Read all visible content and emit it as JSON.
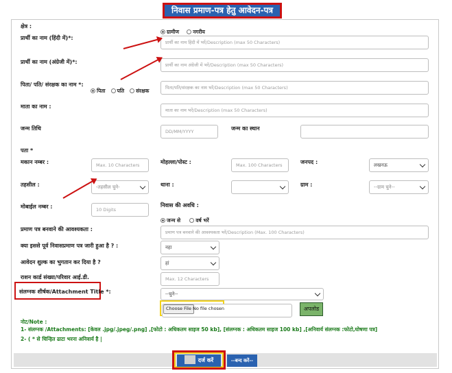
{
  "title": "निवास प्रमाण-पत्र हेतु आवेदन-पत्र",
  "area": {
    "label": "क्षेत्र :",
    "options": [
      "ग्रामीण",
      "नगरीय"
    ],
    "selected": "ग्रामीण"
  },
  "name_hindi": {
    "label": "प्रार्थी का नाम (हिंदी में)*:",
    "placeholder": "प्रार्थी का नाम हिंदी में भरें/Description (max 50 Characters)"
  },
  "name_english": {
    "label": "प्रार्थी का नाम (अंग्रेजी में)*:",
    "placeholder": "प्रार्थी का नाम अंग्रेजी में भरें/Description (max 50 Characters)"
  },
  "guardian": {
    "label": "पिता/ पति/ संरक्षक का नाम *:",
    "options": [
      "पिता",
      "पति",
      "संरक्षक"
    ],
    "selected": "पिता",
    "placeholder": "पिता/पति/संरक्षक का नाम भरें/Description (max 50 Characters)"
  },
  "mother": {
    "label": "माता का नाम :",
    "placeholder": "माता का नाम भरें/Description (max 50 Characters)"
  },
  "dob": {
    "label": "जन्म तिथि",
    "placeholder": "DD/MM/YYYY"
  },
  "birthplace": {
    "label": "जन्म का स्थान"
  },
  "address": {
    "label": "पता *"
  },
  "house": {
    "label": "मकान नम्बर :",
    "placeholder": "Max. 10 Characters"
  },
  "locality": {
    "label": "मोहल्ला/पोस्ट :",
    "placeholder": "Max. 100 Characters"
  },
  "district": {
    "label": "जनपद :",
    "value": "लखनऊ"
  },
  "tehsil": {
    "label": "तहसील :",
    "value": "-तहसील चुने-"
  },
  "police": {
    "label": "थाना :",
    "value": ""
  },
  "village": {
    "label": "ग्राम :",
    "value": "--ग्राम चुने--"
  },
  "mobile": {
    "label": "मोबाईल नम्बर :",
    "placeholder": "10 Digits"
  },
  "residence": {
    "label": "निवास की अवधि :",
    "options": [
      "जन्म से",
      "वर्ष भरें"
    ],
    "selected": "जन्म से"
  },
  "purpose": {
    "label": "प्रमाण पत्र बनवाने की आवश्यकता :",
    "placeholder": "प्रमाण पत्र बनवाने की आवश्यकता भरें/Description (Max. 100 Characters)"
  },
  "prior_cert": {
    "label": "क्या इससे पूर्व निवासप्रमाण पत्र जारी हुआ है ? :",
    "value": "नहा"
  },
  "fee_paid": {
    "label": "आवेदन शुल्क का भुगतान कर दिया है ?",
    "value": "हां"
  },
  "ration": {
    "label": "राशन कार्ड संख्या/परिवार आई.डी.",
    "placeholder": "Max. 12 Characters"
  },
  "attachment": {
    "label": "संलग्नक शीर्षक/Attachment Title *:",
    "value": "--चुने--",
    "file_button": "Choose File",
    "file_status": "No file chosen",
    "upload_label": "अपलोड"
  },
  "notes": {
    "heading": "नोट/Note :",
    "line1": "1- संलग्नक /Attachments: [केवल .jpg/.jpeg/.png] ,[फोटो : अधिकतम साइज 50 kb], [संलग्नक : अधिकतम साइज 100 kb] ,[अनिवार्य संलग्नक :फोटो,घोषणा पत्र]",
    "line2": "2- ( * से चिन्हित ढाटा भरना अनिवार्य है |"
  },
  "buttons": {
    "submit": "दर्ज करें",
    "close": "--बन्द करें--"
  },
  "colors": {
    "header_blue": "#2a62b0",
    "highlight_red": "#cc1111",
    "highlight_yellow": "#f2d21a",
    "note_green": "#1a7a1a",
    "upload_green": "#7bb46a"
  }
}
